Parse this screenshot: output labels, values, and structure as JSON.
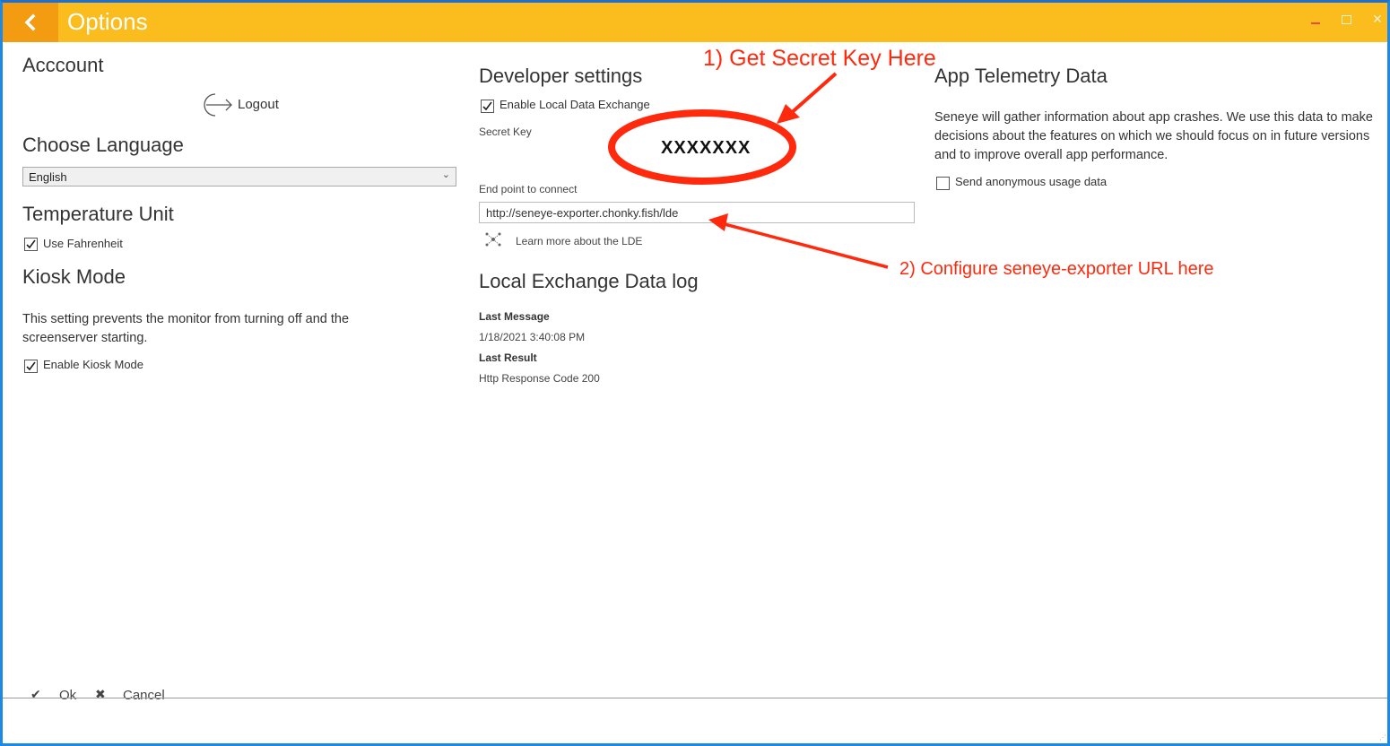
{
  "window": {
    "title": "Options",
    "colors": {
      "titlebar": "#fbbd1d",
      "back_button": "#f39c12",
      "annotation": "#ff2a0e",
      "border": "#1e88e5"
    }
  },
  "account": {
    "heading": "Acccount",
    "logout_label": "Logout"
  },
  "language": {
    "heading": "Choose Language",
    "selected": "English"
  },
  "temperature": {
    "heading": "Temperature Unit",
    "fahrenheit_label": "Use Fahrenheit",
    "fahrenheit_checked": true
  },
  "kiosk": {
    "heading": "Kiosk Mode",
    "description": "This setting prevents the monitor from turning off and the screenserver starting.",
    "enable_label": "Enable Kiosk Mode",
    "enable_checked": true
  },
  "developer": {
    "heading": "Developer settings",
    "enable_lde_label": "Enable Local Data Exchange",
    "enable_lde_checked": true,
    "secret_key_label": "Secret Key",
    "secret_key_value": "XXXXXXX",
    "endpoint_label": "End point to connect",
    "endpoint_value": "http://seneye-exporter.chonky.fish/lde",
    "learn_more": "Learn more about the LDE"
  },
  "lde_log": {
    "heading": "Local Exchange Data log",
    "last_message_label": "Last Message",
    "last_message_value": "1/18/2021 3:40:08 PM",
    "last_result_label": "Last Result",
    "last_result_value": "Http Response Code 200"
  },
  "telemetry": {
    "heading": "App Telemetry Data",
    "description": "Seneye will gather information about app crashes. We use this data to make decisions about the features on which we should focus on in future versions and to improve overall app performance.",
    "send_label": "Send anonymous usage data",
    "send_checked": false
  },
  "footer": {
    "ok_label": "Ok",
    "cancel_label": "Cancel"
  },
  "annotations": {
    "secret_key_note": "1) Get Secret Key Here",
    "url_note": "2) Configure seneye-exporter URL here"
  },
  "icons": {
    "back": "chevron-left-icon",
    "logout": "logout-icon",
    "learn_more": "lde-network-icon",
    "ok": "checkmark-icon",
    "cancel": "x-icon"
  }
}
